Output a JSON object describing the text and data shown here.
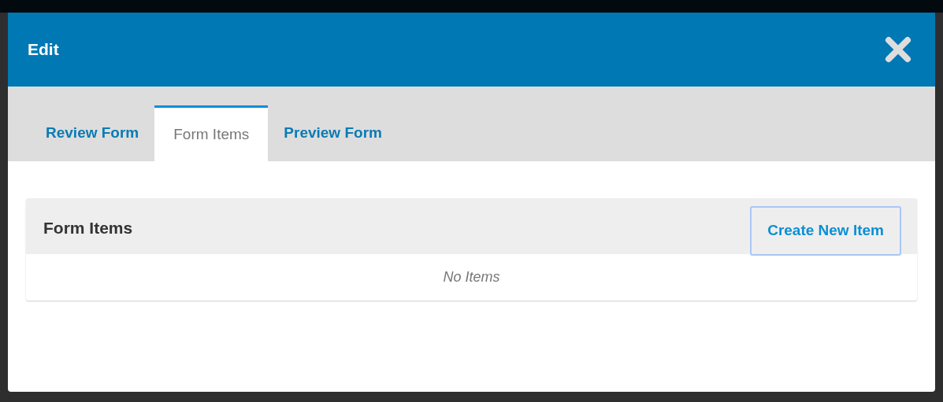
{
  "modal": {
    "title": "Edit"
  },
  "tabs": [
    {
      "label": "Review Form",
      "selected": false
    },
    {
      "label": "Form Items",
      "selected": true
    },
    {
      "label": "Preview Form",
      "selected": false
    }
  ],
  "panel": {
    "title": "Form Items",
    "button": "Create New Item",
    "empty_message": "No Items"
  }
}
